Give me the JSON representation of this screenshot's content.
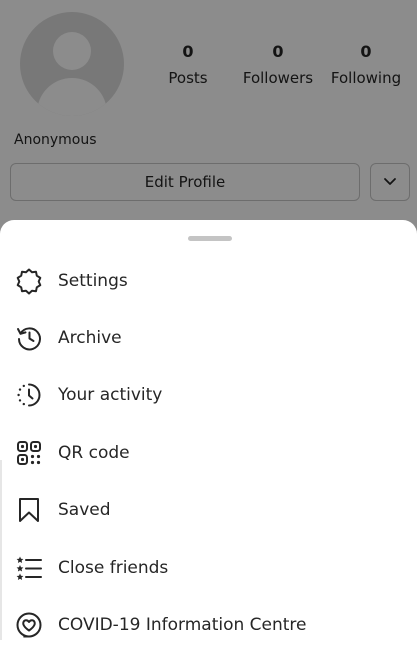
{
  "profile": {
    "stats": [
      {
        "value": "0",
        "label": "Posts"
      },
      {
        "value": "0",
        "label": "Followers"
      },
      {
        "value": "0",
        "label": "Following"
      }
    ],
    "username": "Anonymous",
    "edit_profile_label": "Edit Profile",
    "more_icon": "chevron-down-icon"
  },
  "sheet": {
    "items": [
      {
        "label": "Settings",
        "icon": "settings-gear-icon"
      },
      {
        "label": "Archive",
        "icon": "archive-history-icon"
      },
      {
        "label": "Your activity",
        "icon": "activity-clock-icon"
      },
      {
        "label": "QR code",
        "icon": "qr-code-icon"
      },
      {
        "label": "Saved",
        "icon": "bookmark-icon"
      },
      {
        "label": "Close friends",
        "icon": "close-friends-list-icon"
      },
      {
        "label": "COVID-19 Information Centre",
        "icon": "covid-info-heart-icon"
      }
    ]
  },
  "colors": {
    "text": "#262626",
    "overlay": "rgba(0,0,0,0.45)",
    "border": "#c7c7c7",
    "avatar_bg": "#dbdbdb"
  }
}
